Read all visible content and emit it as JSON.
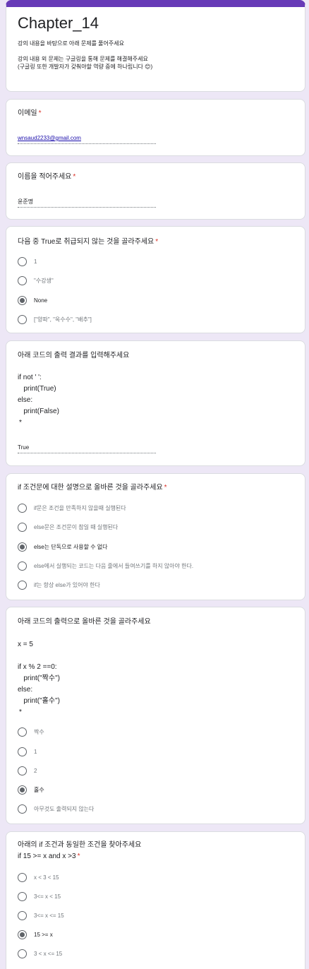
{
  "form": {
    "title": "Chapter_14",
    "description_1": "강의 내용을 바탕으로 아래 문제를 풀어주세요",
    "description_2": "강의 내용 외 문제는 구글링을 통해 문제를 해결해주세요",
    "description_3": "(구글링 또한 개발자가 갖춰야할 역량 중에 하나립니다 😊)"
  },
  "required_mark": "*",
  "email": {
    "label": "이메일",
    "value": "wnsaud2233@gmail.com"
  },
  "name": {
    "label": "이름을 적어주세요",
    "value": "윤준명"
  },
  "q1": {
    "title": "다음 중 True로 취급되지 않는 것을 골라주세요",
    "options": [
      "1",
      "\"수강생\"",
      "None",
      "[\"양파\", \"옥수수\", \"배추\"]"
    ],
    "selected": 2
  },
  "q2": {
    "title": "아래 코드의 출력 결과를 입력해주세요",
    "code": [
      "if not ' ':",
      "   print(True)",
      "else:",
      "   print(False)"
    ],
    "answer": "True"
  },
  "q3": {
    "title": "if 조건문에 대한 설명으로 올바른 것을 골라주세요",
    "options": [
      "if문은 조건을 만족하지 않을때 실행된다",
      "else문은 조건문이 참일 때 실행된다",
      "else는 단독으로 사용할 수 없다",
      "else에서 실행되는 코드는 다음 줄에서 들여쓰기를 하지 않아야 한다.",
      "if는 항상 else가 있어야 한다"
    ],
    "selected": 2
  },
  "q4": {
    "title": "아래 코드의 출력으로 올바른 것을 골라주세요",
    "code": [
      "x = 5",
      "",
      "if x % 2 ==0:",
      "   print(\"짝수\")",
      "else:",
      "   print(\"홀수\")"
    ],
    "options": [
      "짝수",
      "1",
      "2",
      "홀수",
      "아무것도 출력되지 않는다"
    ],
    "selected": 3
  },
  "q5": {
    "title": "아래의 if 조건과 동일한 조건을 찾아주세요",
    "title_2": "if 15 >= x and  x >3",
    "options": [
      "x < 3 < 15",
      "3<= x < 15",
      "3<= x <= 15",
      "15 >= x",
      "3 < x <= 15"
    ],
    "selected": 3
  },
  "colors": {
    "accent": "#673ab7",
    "background": "#ede7f6",
    "required": "#d93025",
    "link": "#1a0dab"
  }
}
